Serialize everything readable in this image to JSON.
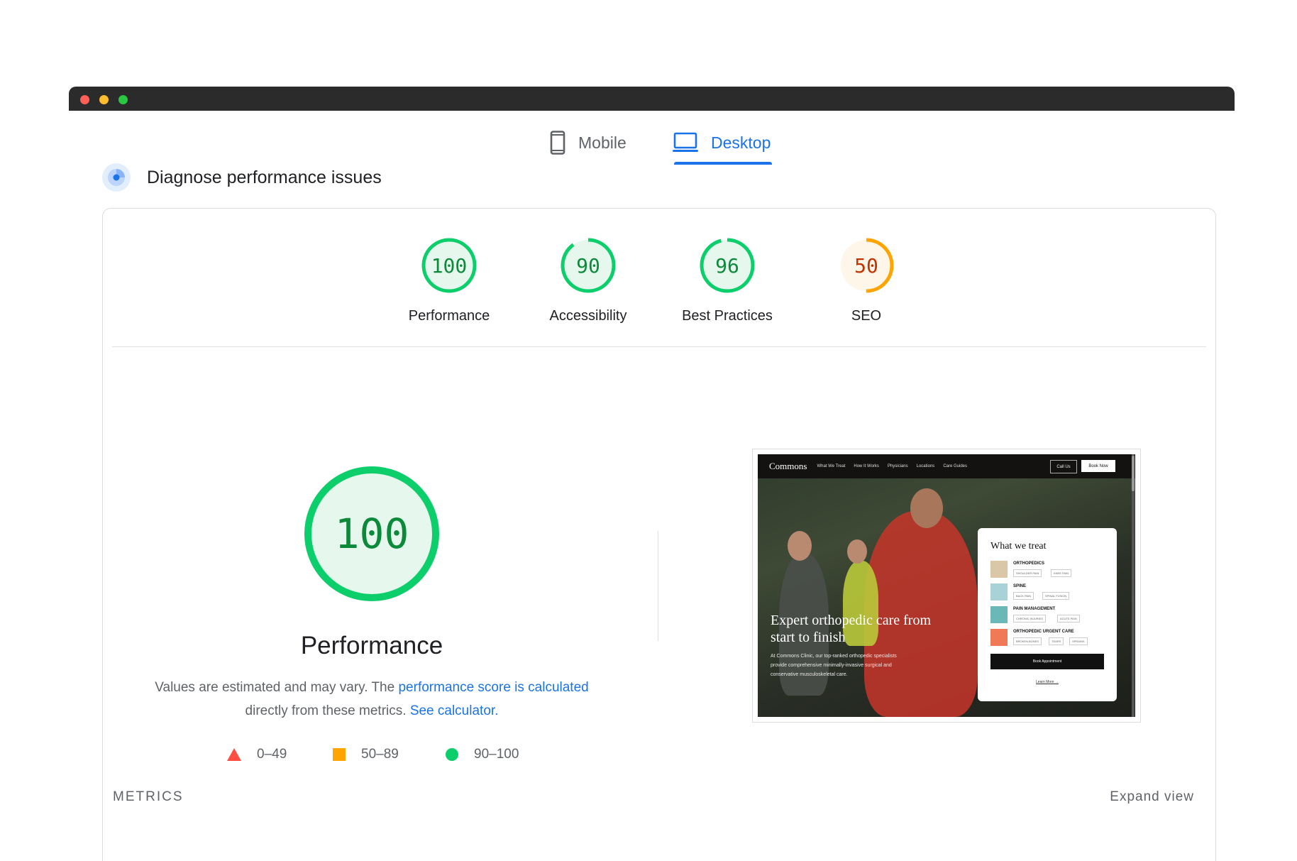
{
  "tabs": {
    "mobile_label": "Mobile",
    "desktop_label": "Desktop",
    "selected": "Desktop"
  },
  "section": {
    "title": "Diagnose performance issues"
  },
  "colors": {
    "pass": "#0cce6b",
    "average": "#ffa400",
    "fail": "#ff4e42",
    "accent": "#1a73e8"
  },
  "scores": [
    {
      "label": "Performance",
      "value": "100",
      "fraction": 1.0,
      "status": "pass"
    },
    {
      "label": "Accessibility",
      "value": "90",
      "fraction": 0.9,
      "status": "pass"
    },
    {
      "label": "Best Practices",
      "value": "96",
      "fraction": 0.96,
      "status": "pass"
    },
    {
      "label": "SEO",
      "value": "50",
      "fraction": 0.5,
      "status": "average"
    }
  ],
  "main": {
    "score": "100",
    "fraction": 1.0,
    "title": "Performance",
    "desc_prefix": "Values are estimated and may vary. The ",
    "desc_link1": "performance score is calculated",
    "desc_middle": "directly from these metrics. ",
    "desc_link2": "See calculator."
  },
  "legend": [
    {
      "icon": "triangle-icon",
      "range": "0–49"
    },
    {
      "icon": "square-icon",
      "range": "50–89"
    },
    {
      "icon": "circle-icon",
      "range": "90–100"
    }
  ],
  "metrics_label": "METRICS",
  "expand_label": "Expand view",
  "thumbnail": {
    "brand": "Commons",
    "nav": [
      "What We Treat",
      "How It Works",
      "Physicians",
      "Locations",
      "Care Guides"
    ],
    "call_label": "Call Us",
    "book_label": "Book Now",
    "headline": "Expert orthopedic care from start to finish",
    "sub": "At Commons Clinic, our top-ranked orthopedic specialists provide comprehensive minimally-invasive surgical and conservative musculoskeletal care.",
    "panel_title": "What we treat",
    "categories": [
      {
        "name": "ORTHOPEDICS",
        "chips": [
          "SHOULDER PAIN",
          "KNEE PAIN"
        ],
        "swatch": "#d9c7a7"
      },
      {
        "name": "SPINE",
        "chips": [
          "BACK PAIN",
          "SPINAL FUSION"
        ],
        "swatch": "#a9d2d8"
      },
      {
        "name": "PAIN MANAGEMENT",
        "chips": [
          "CHRONIC INJURIES",
          "ACUTE PAIN"
        ],
        "swatch": "#6ab8b7"
      },
      {
        "name": "ORTHOPEDIC URGENT CARE",
        "chips": [
          "BROKEN BONES",
          "TEARS",
          "SPRAINS"
        ],
        "swatch": "#f07a55"
      }
    ],
    "panel_button": "Book Appointment",
    "panel_link": "Learn More →"
  }
}
